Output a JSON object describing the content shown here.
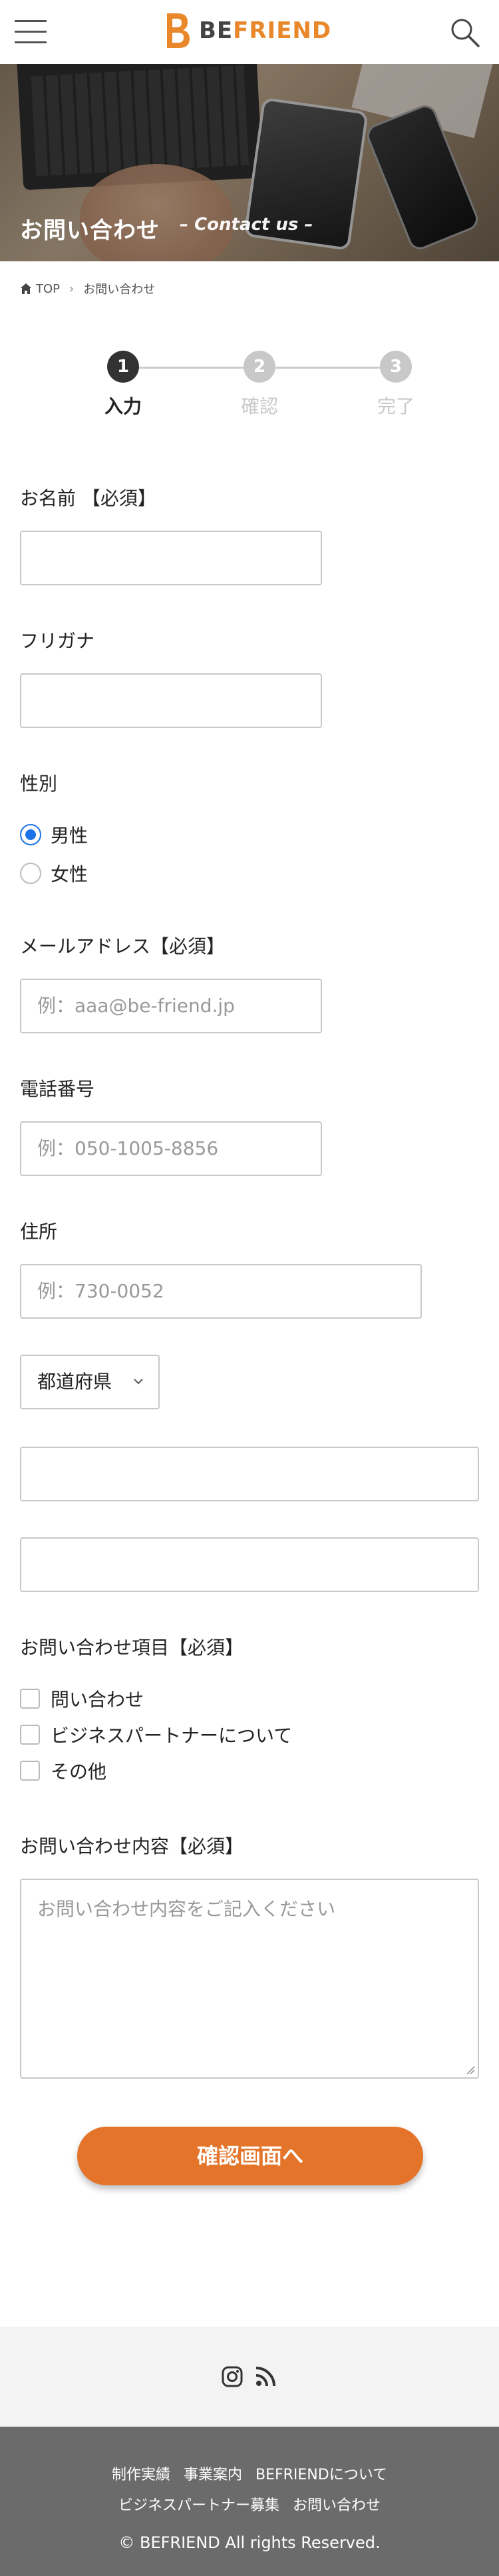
{
  "header": {
    "logo_be": "BE",
    "logo_friend": "FRIEND",
    "brand_color": "#e8882a"
  },
  "hero": {
    "title": "お問い合わせ",
    "subtitle": "– Contact us –"
  },
  "breadcrumb": {
    "home": "TOP",
    "separator": "›",
    "current": "お問い合わせ"
  },
  "steps": [
    {
      "number": "1",
      "label": "入力",
      "state": "active"
    },
    {
      "number": "2",
      "label": "確認",
      "state": "inactive"
    },
    {
      "number": "3",
      "label": "完了",
      "state": "inactive"
    }
  ],
  "form": {
    "name_label": "お名前 【必須】",
    "name_value": "",
    "kana_label": "フリガナ",
    "kana_value": "",
    "gender_label": "性別",
    "gender_options": [
      "男性",
      "女性"
    ],
    "gender_selected": "男性",
    "email_label": "メールアドレス【必須】",
    "email_placeholder": "例：aaa@be-friend.jp",
    "phone_label": "電話番号",
    "phone_placeholder": "例：050-1005-8856",
    "address_label": "住所",
    "zip_placeholder": "例：730-0052",
    "prefecture_select": "都道府県",
    "address1_value": "",
    "address2_value": "",
    "inquiry_type_label": "お問い合わせ項目【必須】",
    "inquiry_types": [
      "問い合わせ",
      "ビジネスパートナーについて",
      "その他"
    ],
    "message_label": "お問い合わせ内容【必須】",
    "message_placeholder": "お問い合わせ内容をご記入ください",
    "submit_label": "確認画面へ",
    "accent_color": "#e3742a"
  },
  "social": {
    "icons": [
      "instagram-icon",
      "rss-icon"
    ]
  },
  "footer": {
    "links": [
      "制作実績",
      "事業案内",
      "BEFRIENDについて",
      "ビジネスパートナー募集",
      "お問い合わせ"
    ],
    "copyright": "© BEFRIEND All rights Reserved."
  }
}
